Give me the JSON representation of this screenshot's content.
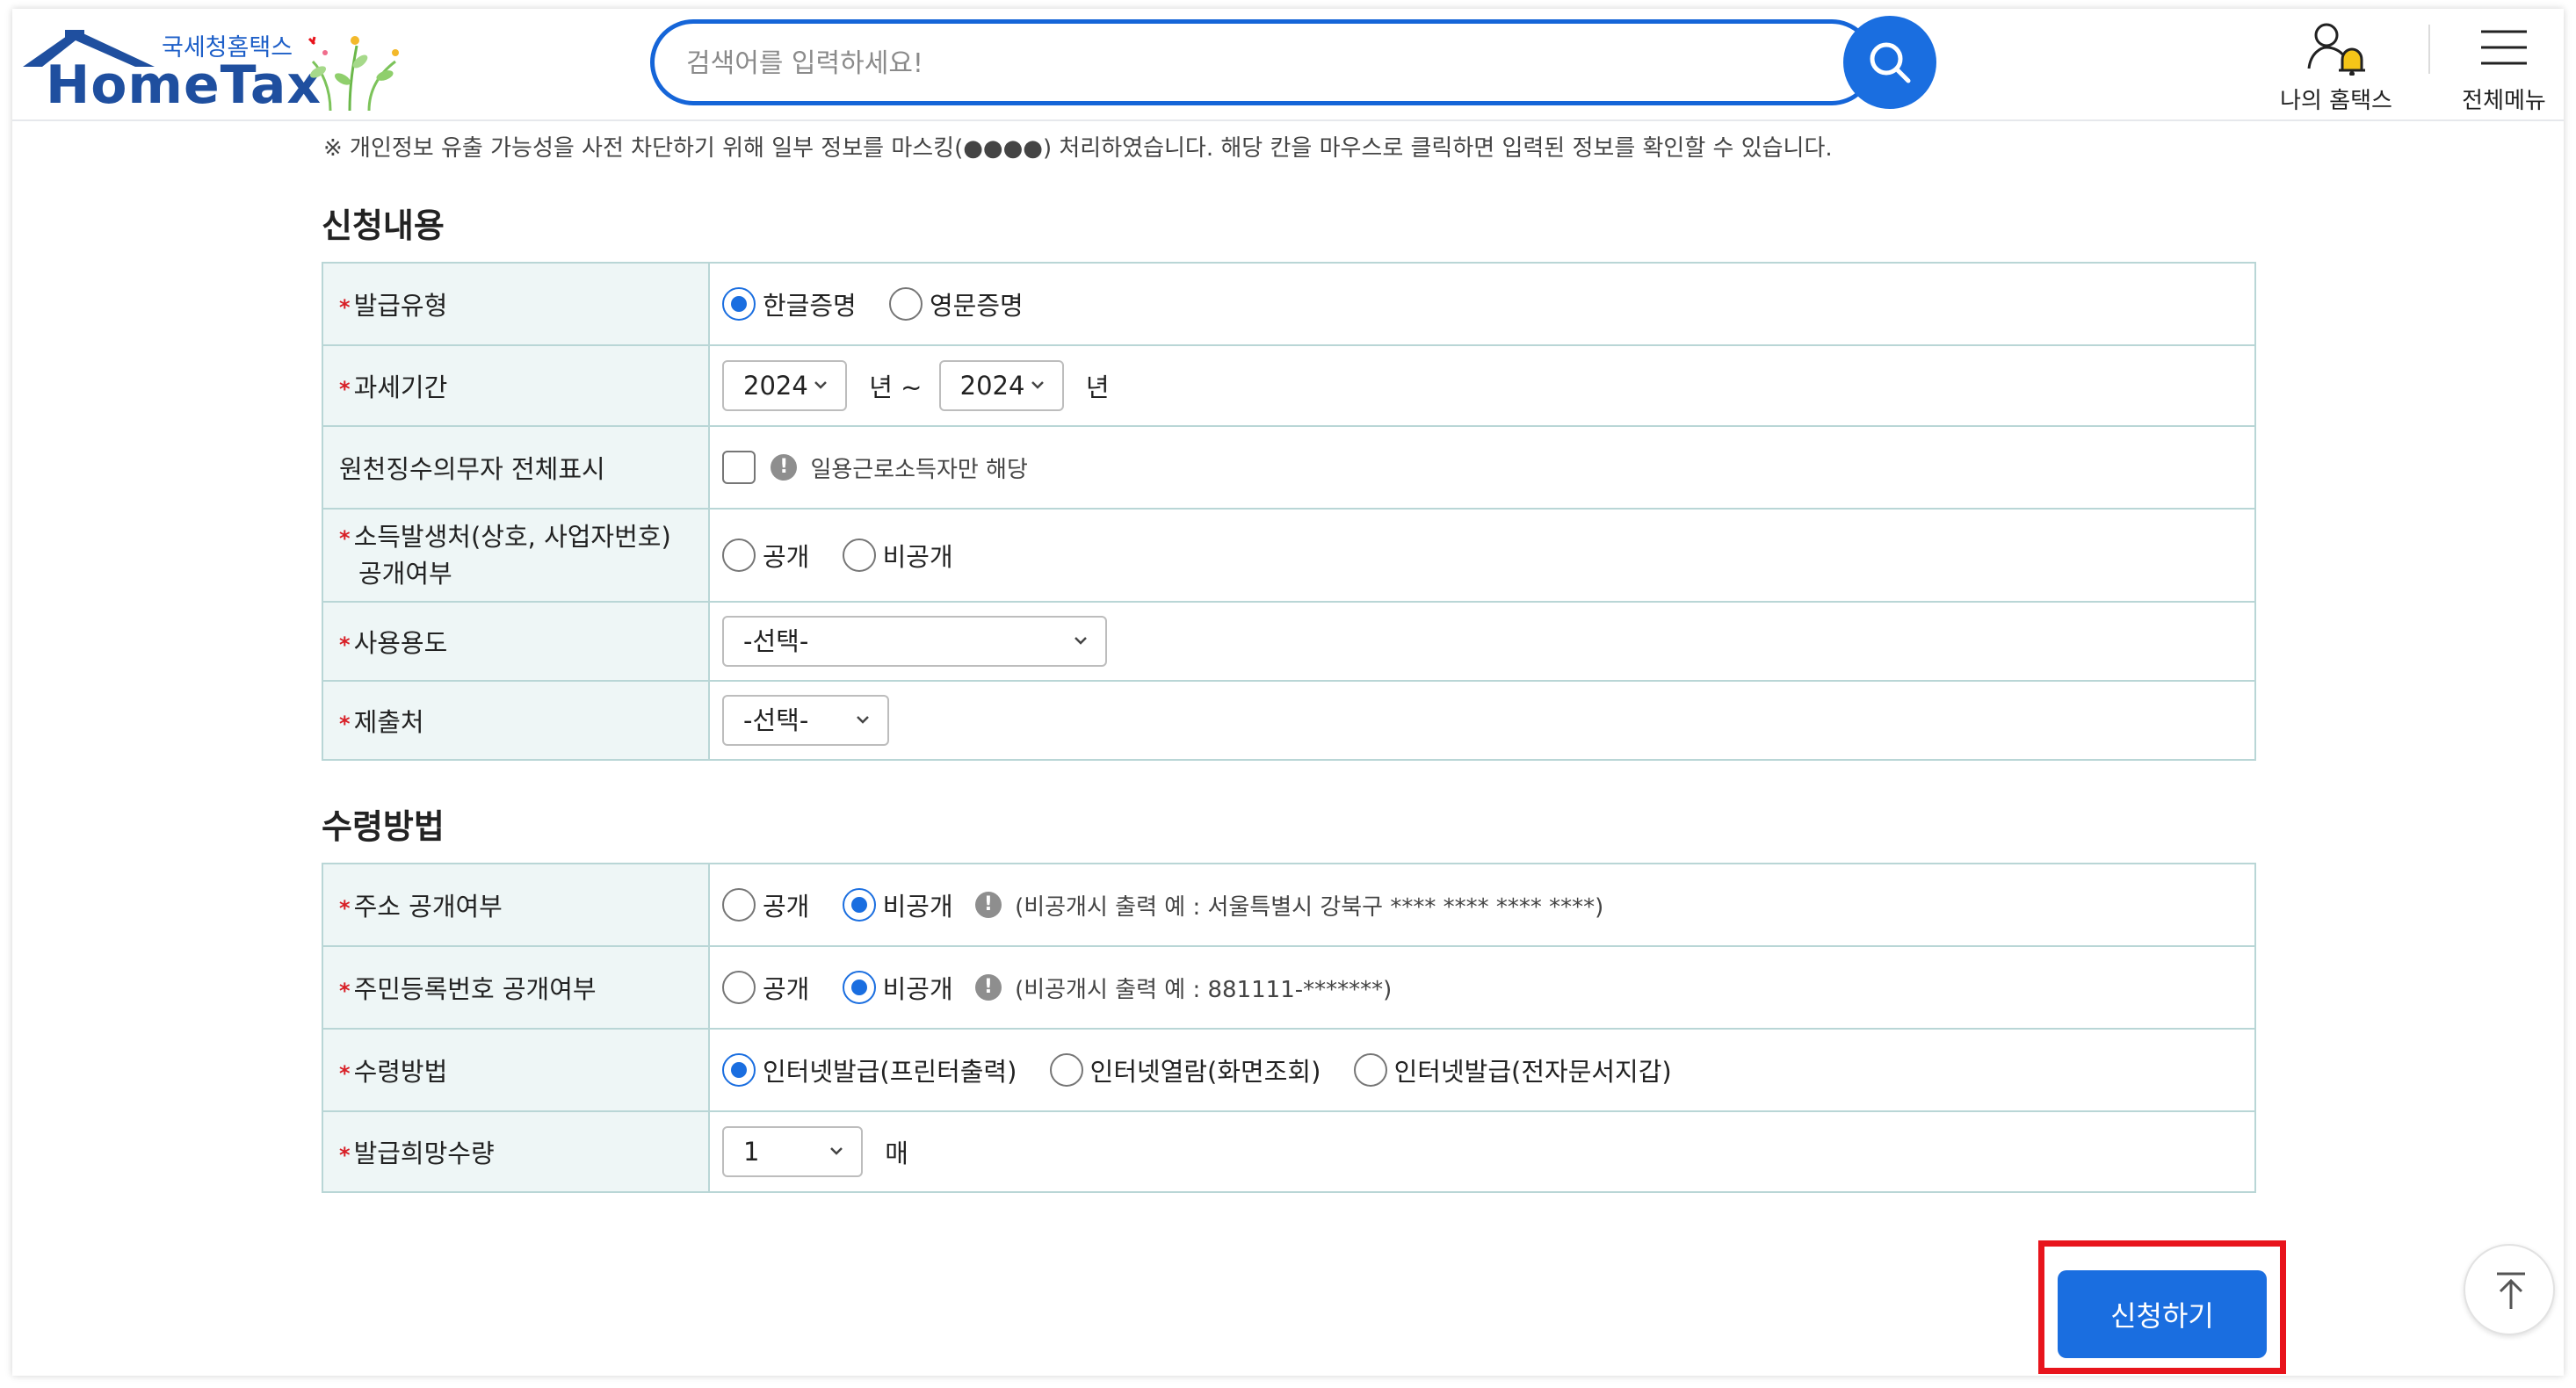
{
  "header": {
    "logo_sub": "국세청홈택스",
    "logo_main": "HomeTax",
    "search_placeholder": "검색어를 입력하세요!",
    "my_hometax_label": "나의 홈택스",
    "all_menu_label": "전체메뉴"
  },
  "notice": "※ 개인정보 유출 가능성을 사전 차단하기 위해 일부 정보를 마스킹(●●●●) 처리하였습니다. 해당 칸을 마우스로 클릭하면 입력된 정보를 확인할 수 있습니다.",
  "application": {
    "title": "신청내용",
    "issue_type": {
      "label": "발급유형",
      "options": [
        "한글증명",
        "영문증명"
      ],
      "selected": "한글증명"
    },
    "tax_period": {
      "label": "과세기간",
      "from": "2024",
      "to": "2024",
      "unit": "년",
      "tilde": "년 ~"
    },
    "withholding": {
      "label": "원천징수의무자 전체표시",
      "hint": "일용근로소득자만 해당"
    },
    "income_source": {
      "label_line1": "소득발생처(상호, 사업자번호)",
      "label_line2": "공개여부",
      "options": [
        "공개",
        "비공개"
      ]
    },
    "purpose": {
      "label": "사용용도",
      "value": "-선택-"
    },
    "submit_to": {
      "label": "제출처",
      "value": "-선택-"
    }
  },
  "receipt": {
    "title": "수령방법",
    "address_public": {
      "label": "주소 공개여부",
      "options": [
        "공개",
        "비공개"
      ],
      "selected": "비공개",
      "hint": "(비공개시 출력 예 : 서울특별시 강북구 **** **** **** ****)"
    },
    "rrn_public": {
      "label": "주민등록번호 공개여부",
      "options": [
        "공개",
        "비공개"
      ],
      "selected": "비공개",
      "hint": "(비공개시 출력 예 : 881111-*******)"
    },
    "method": {
      "label": "수령방법",
      "options": [
        "인터넷발급(프린터출력)",
        "인터넷열람(화면조회)",
        "인터넷발급(전자문서지갑)"
      ],
      "selected": "인터넷발급(프린터출력)"
    },
    "quantity": {
      "label": "발급희망수량",
      "value": "1",
      "unit": "매"
    }
  },
  "submit_label": "신청하기",
  "colors": {
    "accent": "#1a6ee0",
    "highlight": "#e8141c",
    "header_cell": "#eef6f6",
    "border": "#b9d6d6"
  }
}
